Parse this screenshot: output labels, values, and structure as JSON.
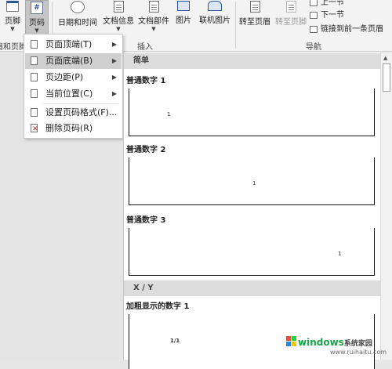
{
  "ribbon": {
    "btn_footer": "页脚",
    "btn_page_number": "页码",
    "btn_datetime": "日期和时间",
    "btn_doc_info": "文档信息",
    "btn_doc_parts": "文档部件",
    "btn_picture": "图片",
    "btn_online_picture": "联机图片",
    "btn_goto_header": "转至页眉",
    "btn_goto_footer": "转至页脚",
    "nav_prev": "上一节",
    "nav_next": "下一节",
    "nav_link_prev": "链接到前一条页眉",
    "group_header_footer": "眉和页脚",
    "group_insert": "插入",
    "group_nav": "导航"
  },
  "menu": {
    "items": [
      {
        "label": "页面顶端(T)",
        "submenu": true,
        "icon": "page-top-icon"
      },
      {
        "label": "页面底端(B)",
        "submenu": true,
        "icon": "page-bottom-icon",
        "highlighted": true
      },
      {
        "label": "页边距(P)",
        "submenu": true,
        "icon": "page-margin-icon"
      },
      {
        "label": "当前位置(C)",
        "submenu": true,
        "icon": "current-position-icon"
      },
      {
        "label": "设置页码格式(F)...",
        "submenu": false,
        "icon": "format-page-number-icon"
      },
      {
        "label": "删除页码(R)",
        "submenu": false,
        "icon": "remove-page-number-icon"
      }
    ]
  },
  "gallery": {
    "category_simple": "简单",
    "item1": "普通数字 1",
    "item2": "普通数字 2",
    "item3": "普通数字 3",
    "category_xy": "X / Y",
    "item4": "加粗显示的数字 1",
    "sample_1": "1",
    "sample_2": "1",
    "sample_3": "1",
    "sample_4": "1/1"
  },
  "watermark": {
    "brand": "windows",
    "suffix": "系统家园",
    "url": "www.ruihaitu.com"
  }
}
